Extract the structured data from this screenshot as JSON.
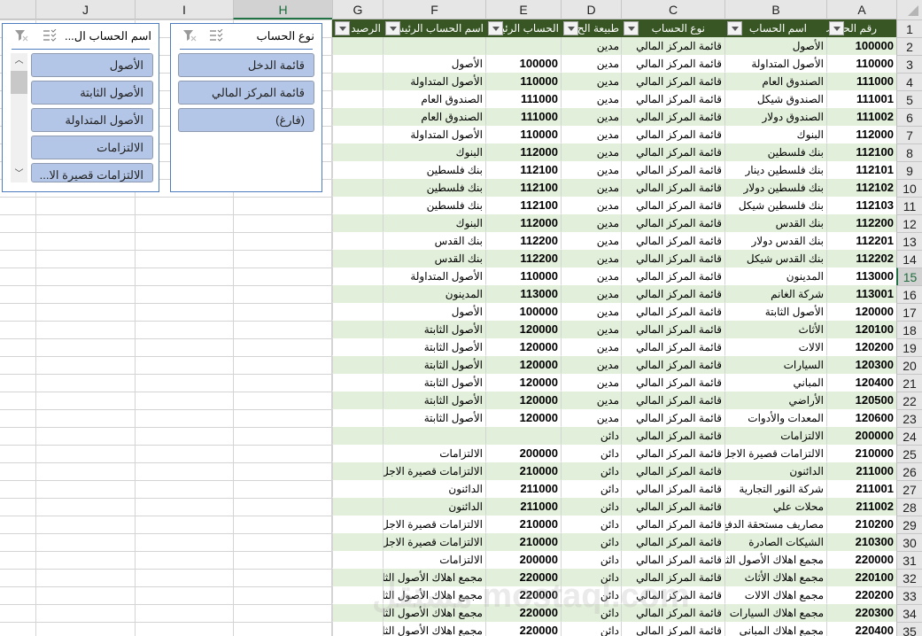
{
  "column_headers": [
    "J",
    "I",
    "H",
    "G",
    "F",
    "E",
    "D",
    "C",
    "B",
    "A"
  ],
  "active_column": "H",
  "active_row": 15,
  "table": {
    "headers": [
      "رقم الحساب",
      "اسم الحساب",
      "نوع الحساب",
      "طبيعة الح",
      "الحساب الرئيس",
      "اسم الحساب الرئيسي",
      "الرصيد"
    ],
    "rows": [
      {
        "n": 2,
        "a": "100000",
        "b": "الأصول",
        "c": "قائمة المركز المالي",
        "d": "مدين",
        "e": "",
        "f": "",
        "g": ""
      },
      {
        "n": 3,
        "a": "110000",
        "b": "الأصول المتداولة",
        "c": "قائمة المركز المالي",
        "d": "مدين",
        "e": "100000",
        "f": "الأصول",
        "g": ""
      },
      {
        "n": 4,
        "a": "111000",
        "b": "الصندوق العام",
        "c": "قائمة المركز المالي",
        "d": "مدين",
        "e": "110000",
        "f": "الأصول المتداولة",
        "g": ""
      },
      {
        "n": 5,
        "a": "111001",
        "b": "الصندوق شيكل",
        "c": "قائمة المركز المالي",
        "d": "مدين",
        "e": "111000",
        "f": "الصندوق العام",
        "g": ""
      },
      {
        "n": 6,
        "a": "111002",
        "b": "الصندوق دولار",
        "c": "قائمة المركز المالي",
        "d": "مدين",
        "e": "111000",
        "f": "الصندوق العام",
        "g": ""
      },
      {
        "n": 7,
        "a": "112000",
        "b": "البنوك",
        "c": "قائمة المركز المالي",
        "d": "مدين",
        "e": "110000",
        "f": "الأصول المتداولة",
        "g": ""
      },
      {
        "n": 8,
        "a": "112100",
        "b": "بنك فلسطين",
        "c": "قائمة المركز المالي",
        "d": "مدين",
        "e": "112000",
        "f": "البنوك",
        "g": ""
      },
      {
        "n": 9,
        "a": "112101",
        "b": "بنك فلسطين دينار",
        "c": "قائمة المركز المالي",
        "d": "مدين",
        "e": "112100",
        "f": "بنك فلسطين",
        "g": ""
      },
      {
        "n": 10,
        "a": "112102",
        "b": "بنك فلسطين دولار",
        "c": "قائمة المركز المالي",
        "d": "مدين",
        "e": "112100",
        "f": "بنك فلسطين",
        "g": ""
      },
      {
        "n": 11,
        "a": "112103",
        "b": "بنك فلسطين شيكل",
        "c": "قائمة المركز المالي",
        "d": "مدين",
        "e": "112100",
        "f": "بنك فلسطين",
        "g": ""
      },
      {
        "n": 12,
        "a": "112200",
        "b": "بنك القدس",
        "c": "قائمة المركز المالي",
        "d": "مدين",
        "e": "112000",
        "f": "البنوك",
        "g": ""
      },
      {
        "n": 13,
        "a": "112201",
        "b": "بنك القدس دولار",
        "c": "قائمة المركز المالي",
        "d": "مدين",
        "e": "112200",
        "f": "بنك القدس",
        "g": ""
      },
      {
        "n": 14,
        "a": "112202",
        "b": "بنك القدس شيكل",
        "c": "قائمة المركز المالي",
        "d": "مدين",
        "e": "112200",
        "f": "بنك القدس",
        "g": ""
      },
      {
        "n": 15,
        "a": "113000",
        "b": "المدينون",
        "c": "قائمة المركز المالي",
        "d": "مدين",
        "e": "110000",
        "f": "الأصول المتداولة",
        "g": ""
      },
      {
        "n": 16,
        "a": "113001",
        "b": "شركة الغانم",
        "c": "قائمة المركز المالي",
        "d": "مدين",
        "e": "113000",
        "f": "المدينون",
        "g": ""
      },
      {
        "n": 17,
        "a": "120000",
        "b": "الأصول الثابتة",
        "c": "قائمة المركز المالي",
        "d": "مدين",
        "e": "100000",
        "f": "الأصول",
        "g": ""
      },
      {
        "n": 18,
        "a": "120100",
        "b": "الأثاث",
        "c": "قائمة المركز المالي",
        "d": "مدين",
        "e": "120000",
        "f": "الأصول الثابتة",
        "g": ""
      },
      {
        "n": 19,
        "a": "120200",
        "b": "الالات",
        "c": "قائمة المركز المالي",
        "d": "مدين",
        "e": "120000",
        "f": "الأصول الثابتة",
        "g": ""
      },
      {
        "n": 20,
        "a": "120300",
        "b": "السيارات",
        "c": "قائمة المركز المالي",
        "d": "مدين",
        "e": "120000",
        "f": "الأصول الثابتة",
        "g": ""
      },
      {
        "n": 21,
        "a": "120400",
        "b": "المباني",
        "c": "قائمة المركز المالي",
        "d": "مدين",
        "e": "120000",
        "f": "الأصول الثابتة",
        "g": ""
      },
      {
        "n": 22,
        "a": "120500",
        "b": "الأراضي",
        "c": "قائمة المركز المالي",
        "d": "مدين",
        "e": "120000",
        "f": "الأصول الثابتة",
        "g": ""
      },
      {
        "n": 23,
        "a": "120600",
        "b": "المعدات والأدوات",
        "c": "قائمة المركز المالي",
        "d": "مدين",
        "e": "120000",
        "f": "الأصول الثابتة",
        "g": ""
      },
      {
        "n": 24,
        "a": "200000",
        "b": "الالتزامات",
        "c": "قائمة المركز المالي",
        "d": "دائن",
        "e": "",
        "f": "",
        "g": ""
      },
      {
        "n": 25,
        "a": "210000",
        "b": "الالتزامات قصيرة الاجل",
        "c": "قائمة المركز المالي",
        "d": "دائن",
        "e": "200000",
        "f": "الالتزامات",
        "g": ""
      },
      {
        "n": 26,
        "a": "211000",
        "b": "الدائنون",
        "c": "قائمة المركز المالي",
        "d": "دائن",
        "e": "210000",
        "f": "الالتزامات قصيرة الاجل",
        "g": ""
      },
      {
        "n": 27,
        "a": "211001",
        "b": "شركة النور التجارية",
        "c": "قائمة المركز المالي",
        "d": "دائن",
        "e": "211000",
        "f": "الدائنون",
        "g": ""
      },
      {
        "n": 28,
        "a": "211002",
        "b": "محلات علي",
        "c": "قائمة المركز المالي",
        "d": "دائن",
        "e": "211000",
        "f": "الدائنون",
        "g": ""
      },
      {
        "n": 29,
        "a": "210200",
        "b": "مصاريف مستحقة الدفع",
        "c": "قائمة المركز المالي",
        "d": "دائن",
        "e": "210000",
        "f": "الالتزامات قصيرة الاجل",
        "g": ""
      },
      {
        "n": 30,
        "a": "210300",
        "b": "الشيكات الصادرة",
        "c": "قائمة المركز المالي",
        "d": "دائن",
        "e": "210000",
        "f": "الالتزامات قصيرة الاجل",
        "g": ""
      },
      {
        "n": 31,
        "a": "220000",
        "b": "مجمع اهلاك الأصول الثابتة",
        "c": "قائمة المركز المالي",
        "d": "دائن",
        "e": "200000",
        "f": "الالتزامات",
        "g": ""
      },
      {
        "n": 32,
        "a": "220100",
        "b": "مجمع اهلاك الأثاث",
        "c": "قائمة المركز المالي",
        "d": "دائن",
        "e": "220000",
        "f": "مجمع اهلاك الأصول الثابتة",
        "g": ""
      },
      {
        "n": 33,
        "a": "220200",
        "b": "مجمع اهلاك الالات",
        "c": "قائمة المركز المالي",
        "d": "دائن",
        "e": "220000",
        "f": "مجمع اهلاك الأصول الثابتة",
        "g": ""
      },
      {
        "n": 34,
        "a": "220300",
        "b": "مجمع اهلاك السيارات",
        "c": "قائمة المركز المالي",
        "d": "دائن",
        "e": "220000",
        "f": "مجمع اهلاك الأصول الثابتة",
        "g": ""
      },
      {
        "n": 35,
        "a": "220400",
        "b": "مجمع اهلاك المباني",
        "c": "قائمة المركز المالي",
        "d": "دائن",
        "e": "220000",
        "f": "مجمع اهلاك الأصول الثابتة",
        "g": ""
      }
    ]
  },
  "slicers": {
    "account_type": {
      "title": "نوع الحساب",
      "items": [
        "قائمة الدخل",
        "قائمة المركز المالي",
        "(فارغ)"
      ]
    },
    "account_name": {
      "title": "اسم الحساب ال...",
      "items": [
        "الأصول",
        "الأصول الثابتة",
        "الأصول المتداولة",
        "الالتزامات",
        "الالتزامات قصيرة الا..."
      ]
    },
    "icons": {
      "multi_select": "☰",
      "clear_filter": "⊽"
    }
  },
  "watermark": "مستقل mostaql.com",
  "colors": {
    "header_green": "#375623",
    "band_green": "#e2efda",
    "slicer_item": "#b4c6e7",
    "slicer_border": "#4f7bbf"
  }
}
